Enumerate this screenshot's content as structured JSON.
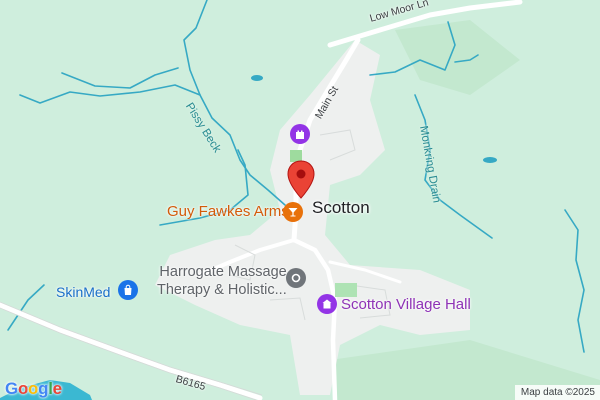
{
  "map": {
    "place_name": "Scotton",
    "roads": {
      "low_moor_ln": "Low Moor Ln",
      "main_st": "Main St",
      "b6165": "B6165"
    },
    "water": {
      "pissy_beck": "Pissy Beck",
      "monkring_drain": "Monkring Drain"
    },
    "pois": {
      "guy_fawkes": "Guy Fawkes Arms",
      "massage_line1": "Harrogate Massage",
      "massage_line2": "Therapy & Holistic...",
      "skinmed": "SkinMed",
      "village_hall": "Scotton Village Hall"
    },
    "attribution": "Map data ©2025",
    "logo": [
      "G",
      "o",
      "o",
      "g",
      "l",
      "e"
    ],
    "colors": {
      "land": "#cfeedd",
      "village": "#eef0ef",
      "water": "#36a9c4",
      "road": "#ffffff",
      "pin": "#ea4335",
      "poi_orange": "#e8710a",
      "poi_purple": "#9334e6",
      "poi_blue": "#1a73e8",
      "poi_gray": "#70757a"
    }
  }
}
